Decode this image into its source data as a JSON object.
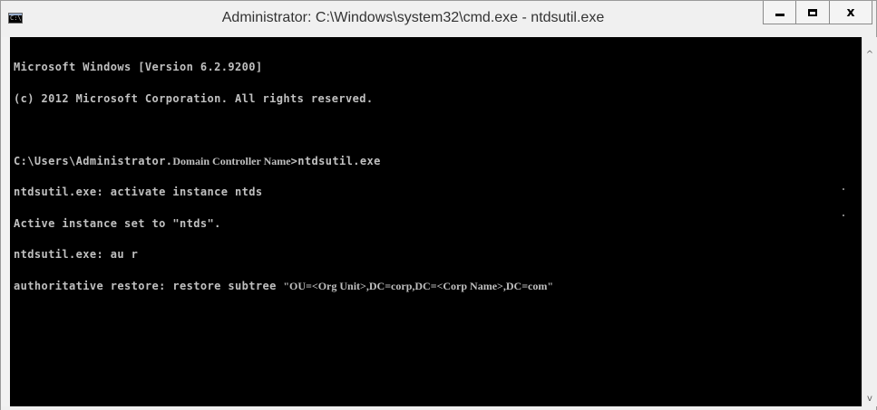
{
  "window": {
    "title": "Administrator: C:\\Windows\\system32\\cmd.exe - ntdsutil.exe",
    "icon_text": "C:\\",
    "icon": "console-app-icon",
    "controls": {
      "minimize_icon": "minimize-icon",
      "maximize_icon": "maximize-icon",
      "close_label": "x"
    }
  },
  "console": {
    "lines": [
      "Microsoft Windows [Version 6.2.9200]",
      "(c) 2012 Microsoft Corporation. All rights reserved."
    ],
    "prompt_path": "C:\\Users\\Administrator.",
    "prompt_placeholder": "Domain Controller Name",
    "prompt_command": ">ntdsutil.exe",
    "line_activate": "ntdsutil.exe: activate instance ntds",
    "line_active_set": "Active instance set to \"ntds\".",
    "line_au": "ntdsutil.exe: au r",
    "restore_prefix": "authoritative restore: restore subtree ",
    "restore_argument": "\"OU=<Org Unit>,DC=corp,DC=<Corp Name>,DC=com\""
  },
  "scrollbar": {
    "up_arrow": "^",
    "down_arrow": "v"
  },
  "colors": {
    "console_background": "#000000",
    "console_text": "#c0c0c0",
    "titlebar": "#f0f0f0"
  }
}
